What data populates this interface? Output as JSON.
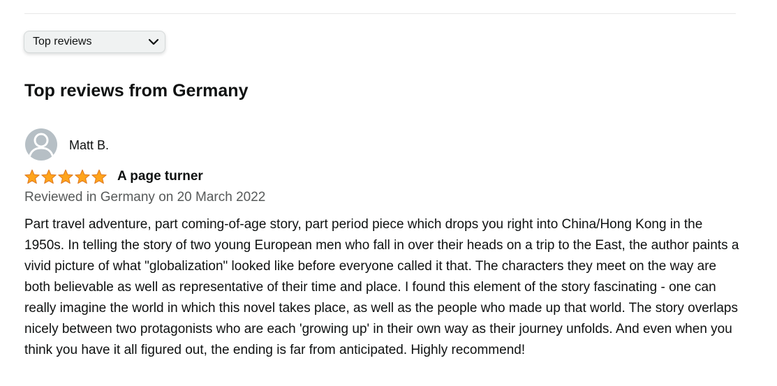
{
  "sort": {
    "selected": "Top reviews"
  },
  "section": {
    "title": "Top reviews from Germany"
  },
  "review": {
    "reviewer_name": "Matt B.",
    "rating": 5,
    "rating_max": 5,
    "title": "A page turner",
    "meta": "Reviewed in Germany on 20 March 2022",
    "body": "Part travel adventure, part coming-of-age story, part period piece which drops you right into China/Hong Kong in the 1950s. In telling the story of two young European men who fall in over their heads on a trip to the East, the author paints a vivid picture of what \"globalization\" looked like before everyone called it that. The characters they meet on the way are both believable as well as representative of their time and place. I found this element of the story fascinating - one can really imagine the world in which this novel takes place, as well as the people who made up that world. The story overlaps nicely between two protagonists who are each 'growing up' in their own way as their journey unfolds. And even when you think you have it all figured out, the ending is far from anticipated. Highly recommend!"
  },
  "colors": {
    "star": "#ffa41c",
    "star_stroke": "#de7921",
    "meta_text": "#565959",
    "avatar_bg": "#b6bfc5"
  },
  "icons": {
    "sort_chevron": "chevron-down-icon",
    "avatar": "user-silhouette-icon",
    "star": "star-filled-icon"
  }
}
